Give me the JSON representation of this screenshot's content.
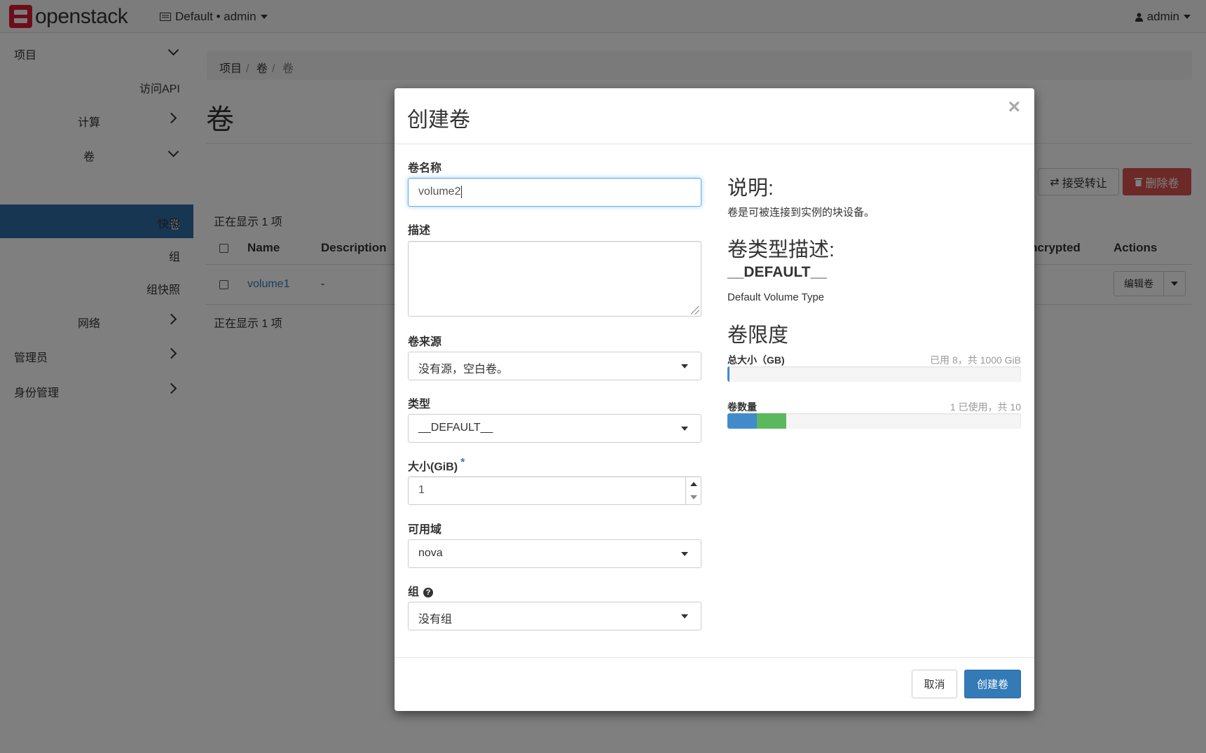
{
  "navbar": {
    "logo_text": "openstack",
    "project_selector": "Default • admin",
    "user_menu": "admin"
  },
  "sidebar": {
    "project": "项目",
    "api_access": "访问API",
    "compute": "计算",
    "volumes": "卷",
    "volumes_active": "卷",
    "snapshots": "快照",
    "groups": "组",
    "group_snapshots": "组快照",
    "network": "网络",
    "admin": "管理员",
    "identity": "身份管理"
  },
  "breadcrumb": [
    "项目",
    "卷",
    "卷"
  ],
  "page": {
    "title": "卷",
    "accept_transfer": "接受转让",
    "delete_volumes": "删除卷",
    "count_top": "正在显示 1 项",
    "count_bottom": "正在显示 1 项"
  },
  "table": {
    "headers": {
      "name": "Name",
      "description": "Description",
      "encrypted": "ncrypted",
      "actions": "Actions"
    },
    "rows": [
      {
        "name": "volume1",
        "description": "-",
        "action": "编辑卷"
      }
    ]
  },
  "modal": {
    "title": "创建卷",
    "close": "×",
    "fields": {
      "name_label": "卷名称",
      "name_value": "volume2",
      "description_label": "描述",
      "description_value": "",
      "source_label": "卷来源",
      "source_value": "没有源，空白卷。",
      "type_label": "类型",
      "type_value": "__DEFAULT__",
      "size_label": "大小(GiB)",
      "size_required": "*",
      "size_value": "1",
      "az_label": "可用域",
      "az_value": "nova",
      "group_label": "组",
      "group_value": "没有组"
    },
    "info": {
      "desc_heading": "说明:",
      "desc_text": "卷是可被连接到实例的块设备。",
      "type_heading": "卷类型描述:",
      "type_name": "__DEFAULT__",
      "type_desc": "Default Volume Type",
      "limits_heading": "卷限度",
      "total_size_label": "总大小（GB)",
      "total_size_usage": "已用 8，共 1000 GiB",
      "total_size_used_fraction": 0.008,
      "count_label": "卷数量",
      "count_usage": "1 已使用，共 10",
      "count_used_fraction": 0.1,
      "count_new_fraction": 0.1,
      "color_used": "#428bca",
      "color_new": "#5cb85c"
    },
    "buttons": {
      "cancel": "取消",
      "create": "创建卷"
    }
  }
}
